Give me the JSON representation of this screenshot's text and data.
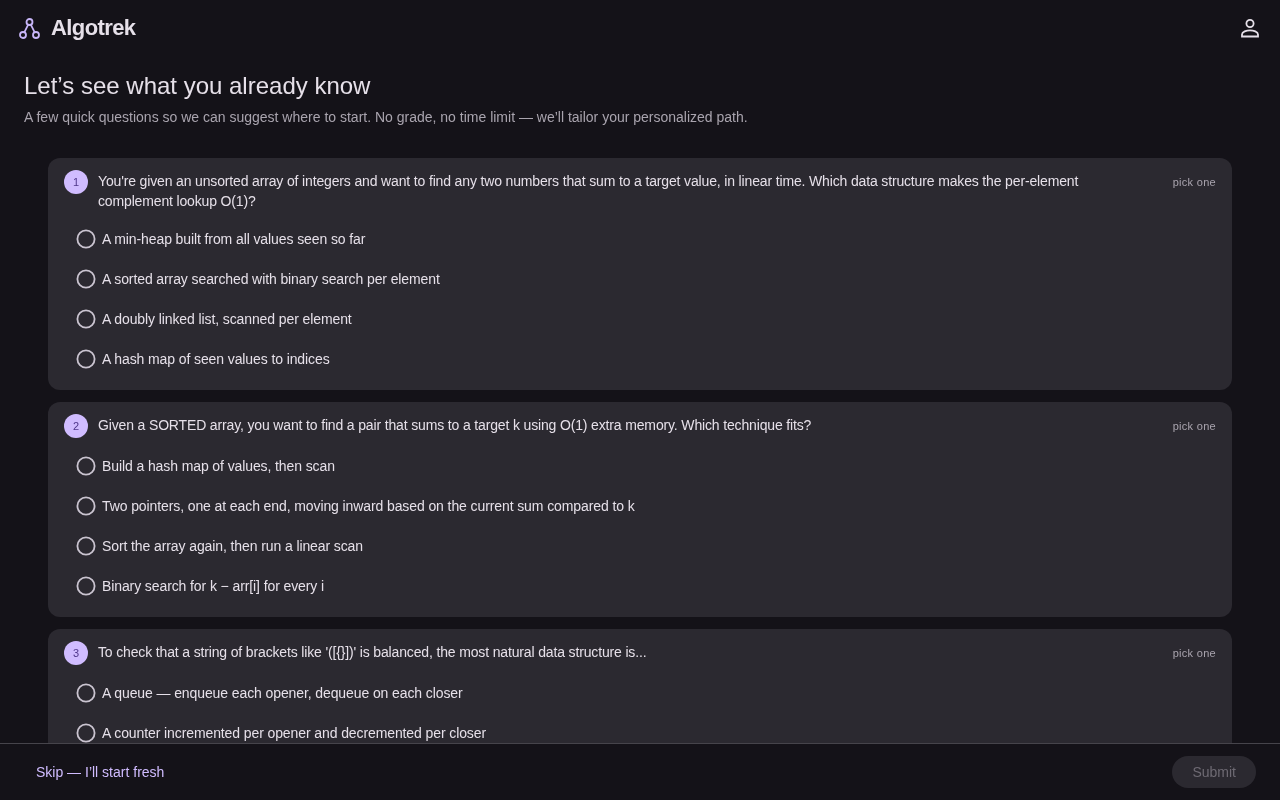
{
  "header": {
    "brand": "Algotrek"
  },
  "intro": {
    "title": "Let’s see what you already know",
    "subtitle": "A few quick questions so we can suggest where to start. No grade, no time limit — we’ll tailor your personalized path."
  },
  "questions": [
    {
      "number": "1",
      "text": "You're given an unsorted array of integers and want to find any two numbers that sum to a target value, in linear time. Which data structure makes the per-element complement lookup O(1)?",
      "hint": "pick one",
      "options": [
        {
          "label": "A min-heap built from all values seen so far",
          "selected": false
        },
        {
          "label": "A sorted array searched with binary search per element",
          "selected": false
        },
        {
          "label": "A doubly linked list, scanned per element",
          "selected": false
        },
        {
          "label": "A hash map of seen values to indices",
          "selected": false
        }
      ]
    },
    {
      "number": "2",
      "text": "Given a SORTED array, you want to find a pair that sums to a target k using O(1) extra memory. Which technique fits?",
      "hint": "pick one",
      "options": [
        {
          "label": "Build a hash map of values, then scan",
          "selected": false
        },
        {
          "label": "Two pointers, one at each end, moving inward based on the current sum compared to k",
          "selected": false
        },
        {
          "label": "Sort the array again, then run a linear scan",
          "selected": false
        },
        {
          "label": "Binary search for k − arr[i] for every i",
          "selected": false
        }
      ]
    },
    {
      "number": "3",
      "text": "To check that a string of brackets like '([{}])' is balanced, the most natural data structure is...",
      "hint": "pick one",
      "options": [
        {
          "label": "A queue — enqueue each opener, dequeue on each closer",
          "selected": false
        },
        {
          "label": "A counter incremented per opener and decremented per closer",
          "selected": false
        }
      ]
    }
  ],
  "footer": {
    "skip_link": "Skip — I’ll start fresh",
    "submit": {
      "label": "Submit",
      "disabled": true
    }
  }
}
